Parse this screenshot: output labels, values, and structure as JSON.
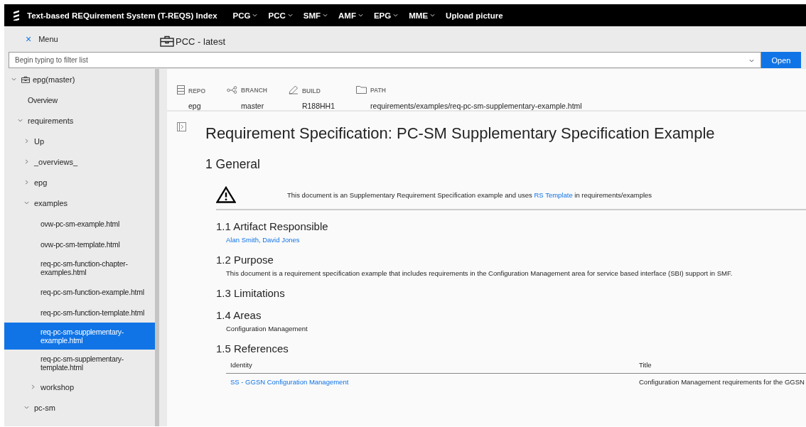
{
  "header": {
    "title": "Text-based REQuirement System (T-REQS) Index",
    "nav": [
      {
        "label": "PCG",
        "dropdown": true
      },
      {
        "label": "PCC",
        "dropdown": true
      },
      {
        "label": "SMF",
        "dropdown": true
      },
      {
        "label": "AMF",
        "dropdown": true
      },
      {
        "label": "EPG",
        "dropdown": true
      },
      {
        "label": "MME",
        "dropdown": true
      },
      {
        "label": "Upload picture",
        "dropdown": false
      }
    ]
  },
  "menu_toggle": {
    "icon": "×",
    "label": "Menu"
  },
  "project": {
    "title": "PCC - latest"
  },
  "filter": {
    "placeholder": "Begin typing to filter list",
    "button": "Open"
  },
  "tree": [
    {
      "label": "epg(master)",
      "kind": "root",
      "expanded": true,
      "children": [
        {
          "label": "Overview",
          "kind": "page",
          "selected": false
        },
        {
          "label": "requirements",
          "kind": "folder",
          "expanded": true,
          "children": [
            {
              "label": "Up",
              "kind": "folder",
              "expanded": false
            },
            {
              "label": "_overviews_",
              "kind": "folder",
              "expanded": false
            },
            {
              "label": "epg",
              "kind": "folder",
              "expanded": false
            },
            {
              "label": "examples",
              "kind": "folder",
              "expanded": true,
              "children": [
                {
                  "label": "ovw-pc-sm-example.html",
                  "kind": "page",
                  "selected": false
                },
                {
                  "label": "ovw-pc-sm-template.html",
                  "kind": "page",
                  "selected": false
                },
                {
                  "label": "req-pc-sm-function-chapter-examples.html",
                  "kind": "page",
                  "selected": false
                },
                {
                  "label": "req-pc-sm-function-example.html",
                  "kind": "page",
                  "selected": false
                },
                {
                  "label": "req-pc-sm-function-template.html",
                  "kind": "page",
                  "selected": false
                },
                {
                  "label": "req-pc-sm-supplementary-example.html",
                  "kind": "page",
                  "selected": true
                },
                {
                  "label": "req-pc-sm-supplementary-template.html",
                  "kind": "page",
                  "selected": false
                },
                {
                  "label": "workshop",
                  "kind": "folder",
                  "expanded": false
                }
              ]
            },
            {
              "label": "pc-sm",
              "kind": "folder",
              "expanded": true
            }
          ]
        }
      ]
    }
  ],
  "meta": [
    {
      "kind": "repo",
      "label": "REPO",
      "value": "epg"
    },
    {
      "kind": "branch",
      "label": "BRANCH",
      "value": "master"
    },
    {
      "kind": "build",
      "label": "BUILD",
      "value": "R188HH1"
    },
    {
      "kind": "path",
      "label": "PATH",
      "value": "requirements/examples/req-pc-sm-supplementary-example.html"
    }
  ],
  "document": {
    "title": "Requirement Specification: PC-SM Supplementary Specification Example",
    "sections": [
      {
        "heading": "1 General",
        "notice": {
          "before": "This document is an Supplementary Requirement Specification example and uses",
          "link": "RS Template",
          "after": "in requirements/examples"
        },
        "subsections": [
          {
            "heading": "1.1 Artifact Responsible",
            "kind": "link",
            "text": "Alan Smith, David Jones"
          },
          {
            "heading": "1.2 Purpose",
            "kind": "text",
            "text": "This document is a requirement specification example that includes requirements in the Configuration Management area for service based interface (SBI) support in SMF."
          },
          {
            "heading": "1.3 Limitations",
            "kind": "empty"
          },
          {
            "heading": "1.4 Areas",
            "kind": "text",
            "text": "Configuration Management"
          },
          {
            "heading": "1.5 References",
            "kind": "table",
            "columns": [
              "Identity",
              "Title"
            ],
            "rows": [
              {
                "cells": [
                  {
                    "text": "SS - GGSN Configuration Management",
                    "link": true
                  },
                  {
                    "text": "Configuration Management requirements for the GGSN",
                    "link": false
                  }
                ]
              }
            ]
          }
        ]
      }
    ]
  }
}
